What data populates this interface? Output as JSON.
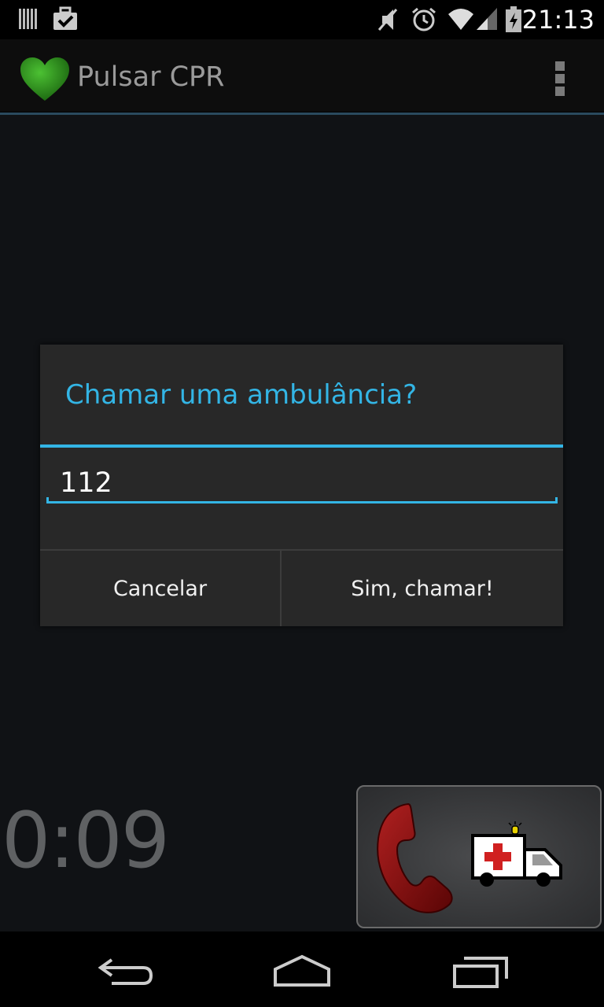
{
  "status_bar": {
    "time": "21:13",
    "left_icons": [
      "barcode-icon",
      "briefcase-check-icon"
    ],
    "right_icons": [
      "mute-icon",
      "alarm-icon",
      "wifi-icon",
      "signal-icon",
      "battery-charging-icon"
    ]
  },
  "action_bar": {
    "title": "Pulsar CPR",
    "logo_icon": "green-heart-icon",
    "overflow_icon": "overflow-menu-icon"
  },
  "main": {
    "timer": "0:09",
    "call_button_icons": [
      "red-phone-icon",
      "ambulance-icon"
    ]
  },
  "dialog": {
    "title": "Chamar uma ambulância?",
    "number_value": "112",
    "cancel_label": "Cancelar",
    "confirm_label": "Sim, chamar!"
  },
  "nav_bar": {
    "icons": [
      "back-icon",
      "home-icon",
      "recent-apps-icon"
    ]
  },
  "colors": {
    "accent": "#33b5e5",
    "dialog_bg": "#282828",
    "heart_green": "#2e8b1e",
    "phone_red": "#8b1010"
  }
}
